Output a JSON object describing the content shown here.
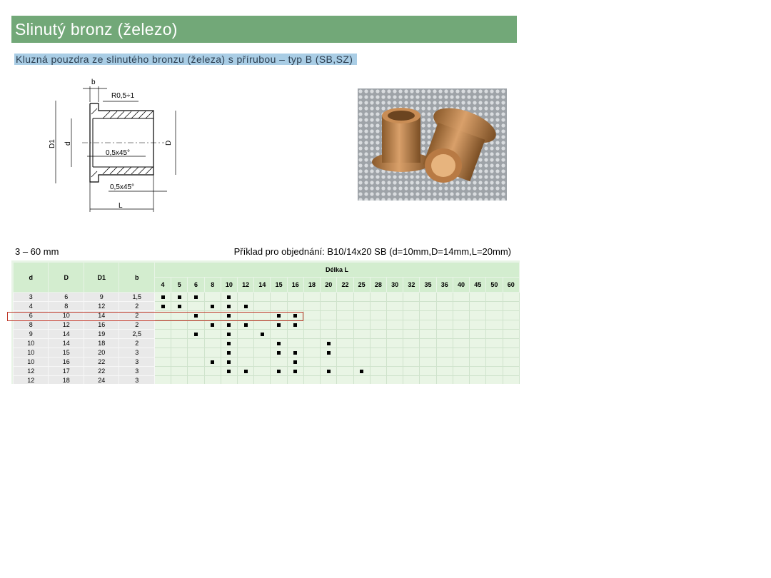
{
  "header": {
    "title": "Slinutý bronz (železo)"
  },
  "subtitle": "Kluzná pouzdra ze slinutého bronzu (železa) s přírubou – typ B (SB,SZ)",
  "drawing": {
    "labels": {
      "b": "b",
      "r": "R0,5÷1",
      "d1": "D1",
      "d": "d",
      "D": "D",
      "chamfer_in": "0,5x45°",
      "chamfer_out": "0,5x45°",
      "L": "L"
    }
  },
  "photo": {
    "alt_icon": "bronze-bushing-photo"
  },
  "info": {
    "range": "3 – 60 mm",
    "example": "Příklad pro objednání: B10/14x20 SB (d=10mm,D=14mm,L=20mm)"
  },
  "table": {
    "headers": {
      "d": "d",
      "D": "D",
      "D1": "D1",
      "b": "b",
      "length": "Délka L"
    },
    "lengths": [
      "4",
      "5",
      "6",
      "8",
      "10",
      "12",
      "14",
      "15",
      "16",
      "18",
      "20",
      "22",
      "25",
      "28",
      "30",
      "32",
      "35",
      "36",
      "40",
      "45",
      "50",
      "60"
    ],
    "rows": [
      {
        "d": "3",
        "D": "6",
        "D1": "9",
        "b": "1,5",
        "avail": [
          "4",
          "5",
          "6",
          "10"
        ]
      },
      {
        "d": "4",
        "D": "8",
        "D1": "12",
        "b": "2",
        "avail": [
          "4",
          "5",
          "8",
          "10",
          "12"
        ]
      },
      {
        "d": "6",
        "D": "10",
        "D1": "14",
        "b": "2",
        "avail": [
          "6",
          "10",
          "15",
          "16"
        ]
      },
      {
        "d": "8",
        "D": "12",
        "D1": "16",
        "b": "2",
        "avail": [
          "8",
          "10",
          "12",
          "15",
          "16"
        ]
      },
      {
        "d": "9",
        "D": "14",
        "D1": "19",
        "b": "2,5",
        "avail": [
          "6",
          "10",
          "14"
        ]
      },
      {
        "d": "10",
        "D": "14",
        "D1": "18",
        "b": "2",
        "avail": [
          "10",
          "15",
          "20"
        ]
      },
      {
        "d": "10",
        "D": "15",
        "D1": "20",
        "b": "3",
        "avail": [
          "10",
          "15",
          "16",
          "20"
        ]
      },
      {
        "d": "10",
        "D": "16",
        "D1": "22",
        "b": "3",
        "avail": [
          "8",
          "10",
          "16"
        ]
      },
      {
        "d": "12",
        "D": "17",
        "D1": "22",
        "b": "3",
        "avail": [
          "10",
          "12",
          "15",
          "16",
          "20",
          "25"
        ]
      },
      {
        "d": "12",
        "D": "18",
        "D1": "24",
        "b": "3",
        "avail": []
      }
    ],
    "highlighted_row": 2,
    "highlight_color": "#c0392b"
  }
}
